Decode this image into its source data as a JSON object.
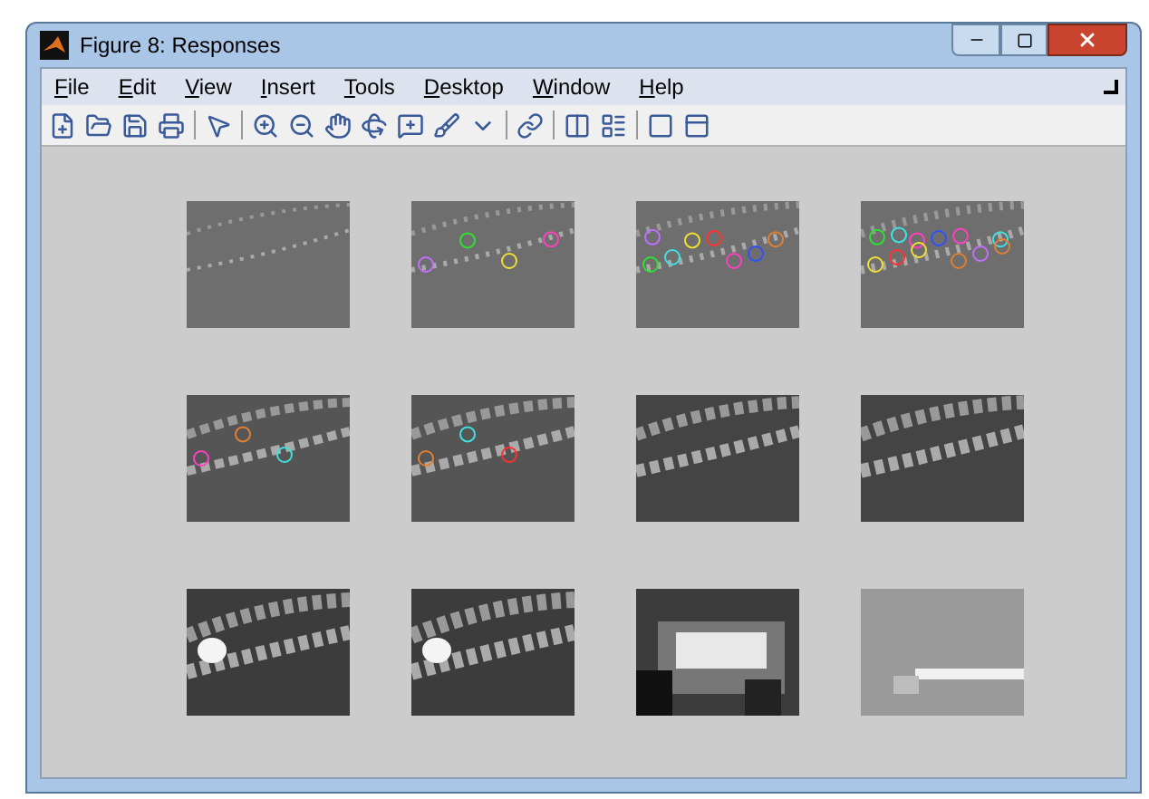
{
  "window": {
    "title": "Figure 8: Responses"
  },
  "menu": [
    "File",
    "Edit",
    "View",
    "Insert",
    "Tools",
    "Desktop",
    "Window",
    "Help"
  ]
}
